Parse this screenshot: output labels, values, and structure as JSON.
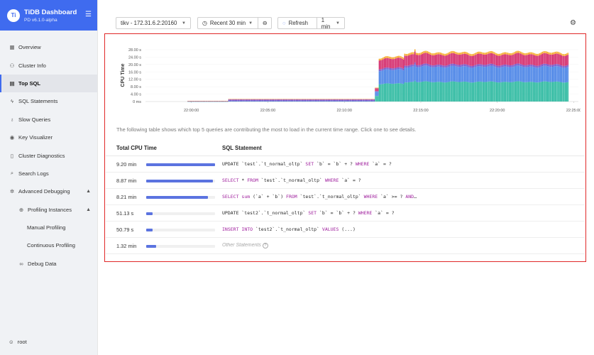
{
  "app": {
    "logo": "Ti",
    "title": "TiDB Dashboard",
    "version": "PD v6.1.0-alpha",
    "collapse_icon": "menu-fold-icon"
  },
  "sidebar": {
    "items": [
      {
        "label": "Overview",
        "icon": "dashboard-icon"
      },
      {
        "label": "Cluster Info",
        "icon": "cluster-icon"
      },
      {
        "label": "Top SQL",
        "icon": "chart-icon",
        "active": true
      },
      {
        "label": "SQL Statements",
        "icon": "thunder-icon"
      },
      {
        "label": "Slow Queries",
        "icon": "experiment-icon"
      },
      {
        "label": "Key Visualizer",
        "icon": "eye-icon"
      },
      {
        "label": "Cluster Diagnostics",
        "icon": "file-icon"
      },
      {
        "label": "Search Logs",
        "icon": "search-file-icon"
      },
      {
        "label": "Advanced Debugging",
        "icon": "bug-icon",
        "expanded": true
      },
      {
        "label": "Profiling Instances",
        "icon": "aim-icon",
        "expanded": true
      },
      {
        "label": "Manual Profiling"
      },
      {
        "label": "Continuous Profiling"
      },
      {
        "label": "Debug Data",
        "icon": "link-icon"
      }
    ],
    "user": "root"
  },
  "toolbar": {
    "instance": "tikv - 172.31.6.2:20160",
    "time_range": "Recent 30 min",
    "refresh": "Refresh",
    "interval": "1 min"
  },
  "chart_data": {
    "type": "bar",
    "stacked": true,
    "ylabel": "CPU Time",
    "yticks": [
      "28.00 s",
      "24.00 s",
      "20.00 s",
      "16.00 s",
      "12.00 s",
      "8.00 s",
      "4.00 s",
      "0 ms"
    ],
    "xticks": [
      "22:00:00",
      "22:05:00",
      "22:10:00",
      "22:15:00",
      "22:20:00",
      "22:25:00"
    ],
    "ylim": [
      0,
      28
    ],
    "series": [
      {
        "color": "#1fb59a"
      },
      {
        "color": "#3d7be5"
      },
      {
        "color": "#6b48c5"
      },
      {
        "color": "#d11d62"
      },
      {
        "color": "#f5a623"
      }
    ],
    "phases": [
      {
        "from_min": 0,
        "to_min": 2.7,
        "total_s": 0
      },
      {
        "from_min": 2.7,
        "to_min": 5.4,
        "total_s": 0.3
      },
      {
        "from_min": 5.4,
        "to_min": 15.0,
        "total_s": 1.4
      },
      {
        "from_min": 15.0,
        "to_min": 15.2,
        "total_s": 7.5
      },
      {
        "from_min": 15.2,
        "to_min": 16.9,
        "total_s": 24.0
      },
      {
        "from_min": 16.9,
        "to_min": 27.6,
        "total_s": 26.5
      }
    ]
  },
  "description": "The following table shows which top 5 queries are contributing the most to load in the current time range. Click one to see details.",
  "table": {
    "headers": {
      "cpu": "Total CPU Time",
      "sql": "SQL Statement"
    },
    "rows": [
      {
        "time": "9.20 min",
        "pct": 1.0,
        "sql": "UPDATE `test`.`t_normal_oltp` SET `b` = `b` + ? WHERE `a` = ?"
      },
      {
        "time": "8.87 min",
        "pct": 0.964,
        "sql": "SELECT * FROM `test`.`t_normal_oltp` WHERE `a` = ?"
      },
      {
        "time": "8.21 min",
        "pct": 0.892,
        "sql": "SELECT sum (`a` + `b`) FROM `test`.`t_normal_oltp` WHERE `a` >= ? AND…"
      },
      {
        "time": "51.13 s",
        "pct": 0.093,
        "sql": "UPDATE `test2`.`t_normal_oltp` SET `b` = `b` + ? WHERE `a` = ?"
      },
      {
        "time": "50.79 s",
        "pct": 0.092,
        "sql": "INSERT INTO `test2`.`t_normal_oltp` VALUES (...)"
      },
      {
        "time": "1.32 min",
        "pct": 0.143,
        "sql": "Other Statements",
        "other": true
      }
    ]
  }
}
